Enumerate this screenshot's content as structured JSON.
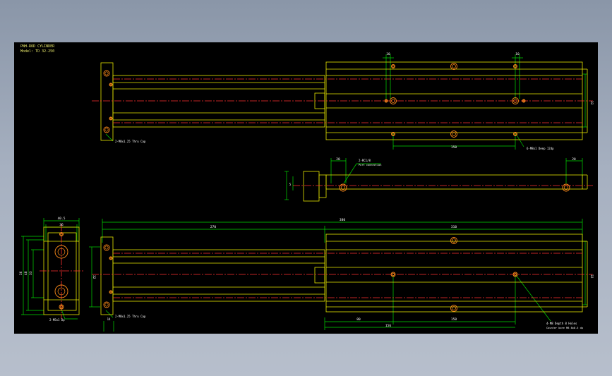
{
  "drawing": {
    "title_lines": [
      "PNH-ROD CYLINDER",
      "Model: TD 32-250"
    ],
    "colors": {
      "background": "#000000",
      "outline": "#e6e600",
      "centerline": "#ff3030",
      "dimension": "#00d800",
      "hole": "#ff8c1a",
      "text": "#ffffff"
    },
    "top_view": {
      "dims": {
        "left_offset": "10",
        "right_offset": "10",
        "pitch": "150",
        "height": "32"
      },
      "labels": {
        "end_note": "2-M8x1.25 Thru Cap",
        "body_note": "6-M8x1 Deep 12dp"
      }
    },
    "side_view": {
      "dims": {
        "left_depth": "20",
        "right_depth": "20",
        "stroke": "5"
      },
      "labels": {
        "port_note": "2-RC1/8",
        "port_sub": "Port connection"
      }
    },
    "front_view": {
      "dims": {
        "outer_width": "40.5",
        "inner_width": "36",
        "h_overall": "56",
        "h_inner": "48",
        "h_center": "33"
      },
      "labels": {
        "bottom_note": "2-M5x1 Dp"
      }
    },
    "bottom_view": {
      "dims": {
        "overall": "380",
        "left_part": "270",
        "right_part": "310",
        "left_height": "32",
        "right_height": "32",
        "lower_a": "80",
        "lower_b": "150",
        "lower_total": "156",
        "end_depth": "14"
      },
      "labels": {
        "end_note": "2-M8x1.25 Thru Cap",
        "hole_note": "4-M8 Depth 8 Holes",
        "hole_note2": "Counter bore M8 8x8.5 dp"
      }
    }
  }
}
